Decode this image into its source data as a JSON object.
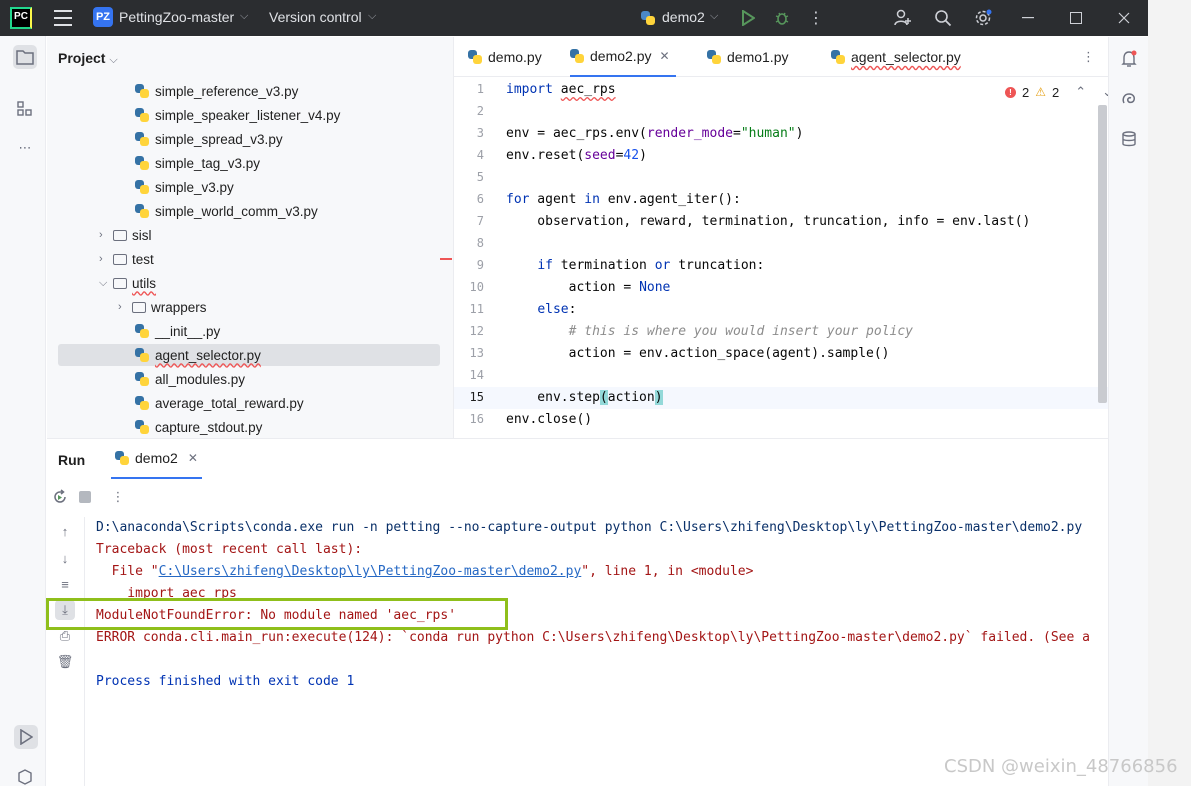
{
  "titlebar": {
    "logo": "PC",
    "project_badge": "PZ",
    "project_name": "PettingZoo-master",
    "vcs": "Version control",
    "run_config": "demo2"
  },
  "project_panel": {
    "header": "Project",
    "items": [
      {
        "label": "simple_reference_v3.py",
        "kind": "py"
      },
      {
        "label": "simple_speaker_listener_v4.py",
        "kind": "py"
      },
      {
        "label": "simple_spread_v3.py",
        "kind": "py"
      },
      {
        "label": "simple_tag_v3.py",
        "kind": "py"
      },
      {
        "label": "simple_v3.py",
        "kind": "py"
      },
      {
        "label": "simple_world_comm_v3.py",
        "kind": "py"
      },
      {
        "label": "sisl",
        "kind": "folder"
      },
      {
        "label": "test",
        "kind": "folder"
      },
      {
        "label": "utils",
        "kind": "folder"
      },
      {
        "label": "wrappers",
        "kind": "folder"
      },
      {
        "label": "__init__.py",
        "kind": "py"
      },
      {
        "label": "agent_selector.py",
        "kind": "py"
      },
      {
        "label": "all_modules.py",
        "kind": "py"
      },
      {
        "label": "average_total_reward.py",
        "kind": "py"
      },
      {
        "label": "capture_stdout.py",
        "kind": "py"
      }
    ]
  },
  "editor": {
    "tabs": [
      "demo.py",
      "demo2.py",
      "demo1.py",
      "agent_selector.py"
    ],
    "active_tab": "demo2.py",
    "errors": "2",
    "warnings": "2",
    "line_numbers": [
      "1",
      "2",
      "3",
      "4",
      "5",
      "6",
      "7",
      "8",
      "9",
      "10",
      "11",
      "12",
      "13",
      "14",
      "15",
      "16"
    ]
  },
  "run_panel": {
    "header": "Run",
    "tab": "demo2",
    "console": {
      "cmd": "D:\\anaconda\\Scripts\\conda.exe run -n petting --no-capture-output python C:\\Users\\zhifeng\\Desktop\\ly\\PettingZoo-master\\demo2.py",
      "traceback": "Traceback (most recent call last):",
      "file_prefix": "  File \"",
      "file_link": "C:\\Users\\zhifeng\\Desktop\\ly\\PettingZoo-master\\demo2.py",
      "file_suffix": "\", line 1, in <module>",
      "import_line": "    import aec_rps",
      "error": "ModuleNotFoundError: No module named 'aec_rps'",
      "conda_error": "ERROR conda.cli.main_run:execute(124): `conda run python C:\\Users\\zhifeng\\Desktop\\ly\\PettingZoo-master\\demo2.py` failed. (See a",
      "finished": "Process finished with exit code 1"
    }
  },
  "watermark": "CSDN @weixin_48766856"
}
